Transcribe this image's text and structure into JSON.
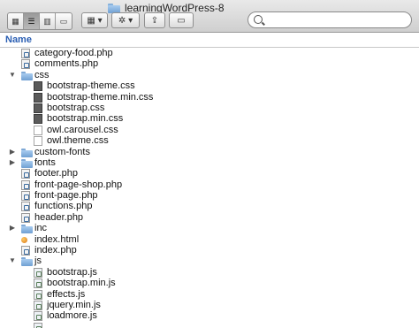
{
  "window": {
    "title": "learningWordPress-8"
  },
  "toolbar": {
    "view_buttons": [
      {
        "icon": "icon-view-icon",
        "label": "▦"
      },
      {
        "icon": "list-view-icon",
        "label": "☰"
      },
      {
        "icon": "column-view-icon",
        "label": "▥"
      },
      {
        "icon": "cover-flow-icon",
        "label": "▭"
      }
    ],
    "arrange_button": {
      "icon": "arrange-icon",
      "label": "▦ ▾"
    },
    "action_button": {
      "icon": "gear-icon",
      "label": "✲ ▾"
    },
    "share_button": {
      "icon": "share-icon",
      "label": "⇪"
    },
    "tag_button": {
      "icon": "tag-icon",
      "label": "▭"
    },
    "search": {
      "placeholder": "",
      "value": ""
    }
  },
  "header": {
    "name_label": "Name"
  },
  "rows": [
    {
      "label": "category-food.php",
      "depth": 1,
      "icon": "php-file-icon",
      "disclosure": ""
    },
    {
      "label": "comments.php",
      "depth": 1,
      "icon": "php-file-icon",
      "disclosure": ""
    },
    {
      "label": "css",
      "depth": 1,
      "icon": "folder-icon",
      "disclosure": "open"
    },
    {
      "label": "bootstrap-theme.css",
      "depth": 2,
      "icon": "css-file-icon",
      "disclosure": ""
    },
    {
      "label": "bootstrap-theme.min.css",
      "depth": 2,
      "icon": "css-file-icon",
      "disclosure": ""
    },
    {
      "label": "bootstrap.css",
      "depth": 2,
      "icon": "css-file-icon",
      "disclosure": ""
    },
    {
      "label": "bootstrap.min.css",
      "depth": 2,
      "icon": "css-file-icon",
      "disclosure": ""
    },
    {
      "label": "owl.carousel.css",
      "depth": 2,
      "icon": "blank-file-icon",
      "disclosure": ""
    },
    {
      "label": "owl.theme.css",
      "depth": 2,
      "icon": "blank-file-icon",
      "disclosure": ""
    },
    {
      "label": "custom-fonts",
      "depth": 1,
      "icon": "folder-icon",
      "disclosure": "closed"
    },
    {
      "label": "fonts",
      "depth": 1,
      "icon": "folder-icon",
      "disclosure": "closed"
    },
    {
      "label": "footer.php",
      "depth": 1,
      "icon": "php-file-icon",
      "disclosure": ""
    },
    {
      "label": "front-page-shop.php",
      "depth": 1,
      "icon": "php-file-icon",
      "disclosure": ""
    },
    {
      "label": "front-page.php",
      "depth": 1,
      "icon": "php-file-icon",
      "disclosure": ""
    },
    {
      "label": "functions.php",
      "depth": 1,
      "icon": "php-file-icon",
      "disclosure": ""
    },
    {
      "label": "header.php",
      "depth": 1,
      "icon": "php-file-icon",
      "disclosure": ""
    },
    {
      "label": "inc",
      "depth": 1,
      "icon": "folder-icon",
      "disclosure": "closed"
    },
    {
      "label": "index.html",
      "depth": 1,
      "icon": "html-file-icon",
      "disclosure": ""
    },
    {
      "label": "index.php",
      "depth": 1,
      "icon": "php-file-icon",
      "disclosure": ""
    },
    {
      "label": "js",
      "depth": 1,
      "icon": "folder-icon",
      "disclosure": "open"
    },
    {
      "label": "bootstrap.js",
      "depth": 2,
      "icon": "js-file-icon",
      "disclosure": ""
    },
    {
      "label": "bootstrap.min.js",
      "depth": 2,
      "icon": "js-file-icon",
      "disclosure": ""
    },
    {
      "label": "effects.js",
      "depth": 2,
      "icon": "js-file-icon",
      "disclosure": ""
    },
    {
      "label": "jquery.min.js",
      "depth": 2,
      "icon": "js-file-icon",
      "disclosure": ""
    },
    {
      "label": "loadmore.js",
      "depth": 2,
      "icon": "js-file-icon",
      "disclosure": ""
    },
    {
      "label": "",
      "depth": 2,
      "icon": "js-file-icon",
      "disclosure": ""
    }
  ]
}
